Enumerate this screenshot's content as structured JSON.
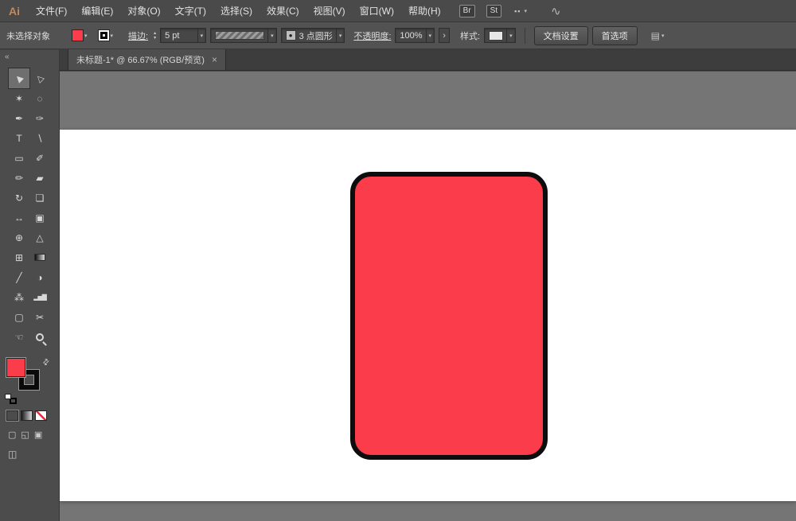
{
  "app": {
    "logo_text": "Ai"
  },
  "menubar": {
    "menus": [
      {
        "id": "menu-file",
        "label": "文件(F)"
      },
      {
        "id": "menu-edit",
        "label": "编辑(E)"
      },
      {
        "id": "menu-object",
        "label": "对象(O)"
      },
      {
        "id": "menu-type",
        "label": "文字(T)"
      },
      {
        "id": "menu-select",
        "label": "选择(S)"
      },
      {
        "id": "menu-effect",
        "label": "效果(C)"
      },
      {
        "id": "menu-view",
        "label": "视图(V)"
      },
      {
        "id": "menu-window",
        "label": "窗口(W)"
      },
      {
        "id": "menu-help",
        "label": "帮助(H)"
      }
    ],
    "br_button": "Br",
    "st_button": "St",
    "arrange_glyph": "▪▪",
    "caret": "▾",
    "squiggle_glyph": "∿"
  },
  "control_bar": {
    "selection_status": "未选择对象",
    "fill_color": "#fa3c4b",
    "stroke_color": "#000000",
    "fill_caret": "▾",
    "stroke_caret": "▾",
    "stroke_label": "描边:",
    "stepper_up": "▴",
    "stepper_down": "▾",
    "stroke_weight": "5 pt",
    "weight_caret": "▾",
    "profile_caret": "▾",
    "brush_dot": "●",
    "brush_name": "3 点圆形",
    "brush_caret": "▾",
    "opacity_label": "不透明度:",
    "opacity_value": "100%",
    "opacity_caret": "▾",
    "opacity_expand": "›",
    "style_label": "样式:",
    "style_caret": "▾",
    "document_setup_label": "文档设置",
    "preferences_label": "首选项",
    "more_icon_glyph": "▤",
    "more_caret": "▾"
  },
  "document_tab": {
    "title": "未标题-1* @ 66.67% (RGB/预览)",
    "close_glyph": "×"
  },
  "toolbar": {
    "collapse_glyph": "«",
    "tools": [
      {
        "id": "selection-tool",
        "glyph": "▶",
        "cls": "rot-nw",
        "active": true
      },
      {
        "id": "direct-selection-tool",
        "glyph": "▷",
        "cls": "rot-nw"
      },
      {
        "id": "magic-wand-tool",
        "glyph": "✶"
      },
      {
        "id": "lasso-tool",
        "glyph": "◌"
      },
      {
        "id": "pen-tool",
        "glyph": "✒"
      },
      {
        "id": "curvature-tool",
        "glyph": "✑"
      },
      {
        "id": "type-tool",
        "glyph": "T"
      },
      {
        "id": "line-segment-tool",
        "glyph": "∖"
      },
      {
        "id": "rectangle-tool",
        "glyph": "▭"
      },
      {
        "id": "paintbrush-tool",
        "glyph": "✐"
      },
      {
        "id": "pencil-tool",
        "glyph": "✏"
      },
      {
        "id": "eraser-tool",
        "glyph": "▰"
      },
      {
        "id": "rotate-tool",
        "glyph": "↻"
      },
      {
        "id": "scale-tool",
        "glyph": "❏"
      },
      {
        "id": "width-tool",
        "glyph": "↔"
      },
      {
        "id": "free-transform-tool",
        "glyph": "▣"
      },
      {
        "id": "shape-builder-tool",
        "glyph": "⊕"
      },
      {
        "id": "perspective-grid-tool",
        "glyph": "△"
      },
      {
        "id": "mesh-tool",
        "glyph": "⊞"
      },
      {
        "id": "gradient-tool",
        "glyph": "",
        "cls": "grad"
      },
      {
        "id": "eyedropper-tool",
        "glyph": "╱"
      },
      {
        "id": "blend-tool",
        "glyph": "◑"
      },
      {
        "id": "symbol-sprayer-tool",
        "glyph": "⁂"
      },
      {
        "id": "column-graph-tool",
        "glyph": "▂▅▇",
        "cls": "bars"
      },
      {
        "id": "artboard-tool",
        "glyph": "▢"
      },
      {
        "id": "slice-tool",
        "glyph": "✂"
      },
      {
        "id": "hand-tool",
        "glyph": "☜"
      },
      {
        "id": "zoom-tool",
        "glyph": "",
        "cls": "zoom"
      }
    ],
    "fill_color": "#fa3c4b",
    "stroke_color": "#0a0a0a",
    "swap_glyph": "⇄",
    "color_mode_buttons": [
      {
        "id": "color-button",
        "cls": "cgn-color pressed"
      },
      {
        "id": "gradient-button",
        "cls": "cgn-grad"
      },
      {
        "id": "none-button",
        "cls": "cgn-none"
      }
    ],
    "draw_modes": [
      {
        "id": "draw-normal-button",
        "glyph": "▢"
      },
      {
        "id": "draw-behind-button",
        "glyph": "◱"
      },
      {
        "id": "draw-inside-button",
        "glyph": "▣"
      }
    ],
    "screen_mode_glyph": "◫"
  },
  "canvas": {
    "pasteboard_color": "#757575",
    "artboard_color": "#ffffff",
    "shape": {
      "id": "red-rounded-rectangle",
      "type": "rounded-rectangle",
      "fill": "#fa3c4b",
      "stroke": "#0d0d0d",
      "stroke_weight": "5 pt"
    }
  }
}
